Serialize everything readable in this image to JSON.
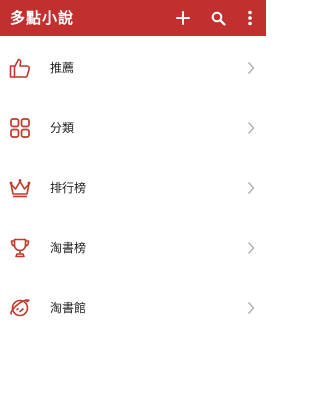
{
  "appbar": {
    "title": "多點小說",
    "actions": [
      {
        "icon": "add-icon"
      },
      {
        "icon": "search-icon"
      },
      {
        "icon": "more-vertical-icon"
      }
    ]
  },
  "menu": {
    "items": [
      {
        "icon": "thumbs-up-icon",
        "label": "推薦"
      },
      {
        "icon": "grid-icon",
        "label": "分類"
      },
      {
        "icon": "crown-icon",
        "label": "排行榜"
      },
      {
        "icon": "trophy-icon",
        "label": "淘書榜"
      },
      {
        "icon": "planet-icon",
        "label": "淘書館"
      }
    ]
  },
  "colors": {
    "brand": "#c12f2f",
    "icon": "#c0392b",
    "chevron": "#b0b0b0"
  }
}
